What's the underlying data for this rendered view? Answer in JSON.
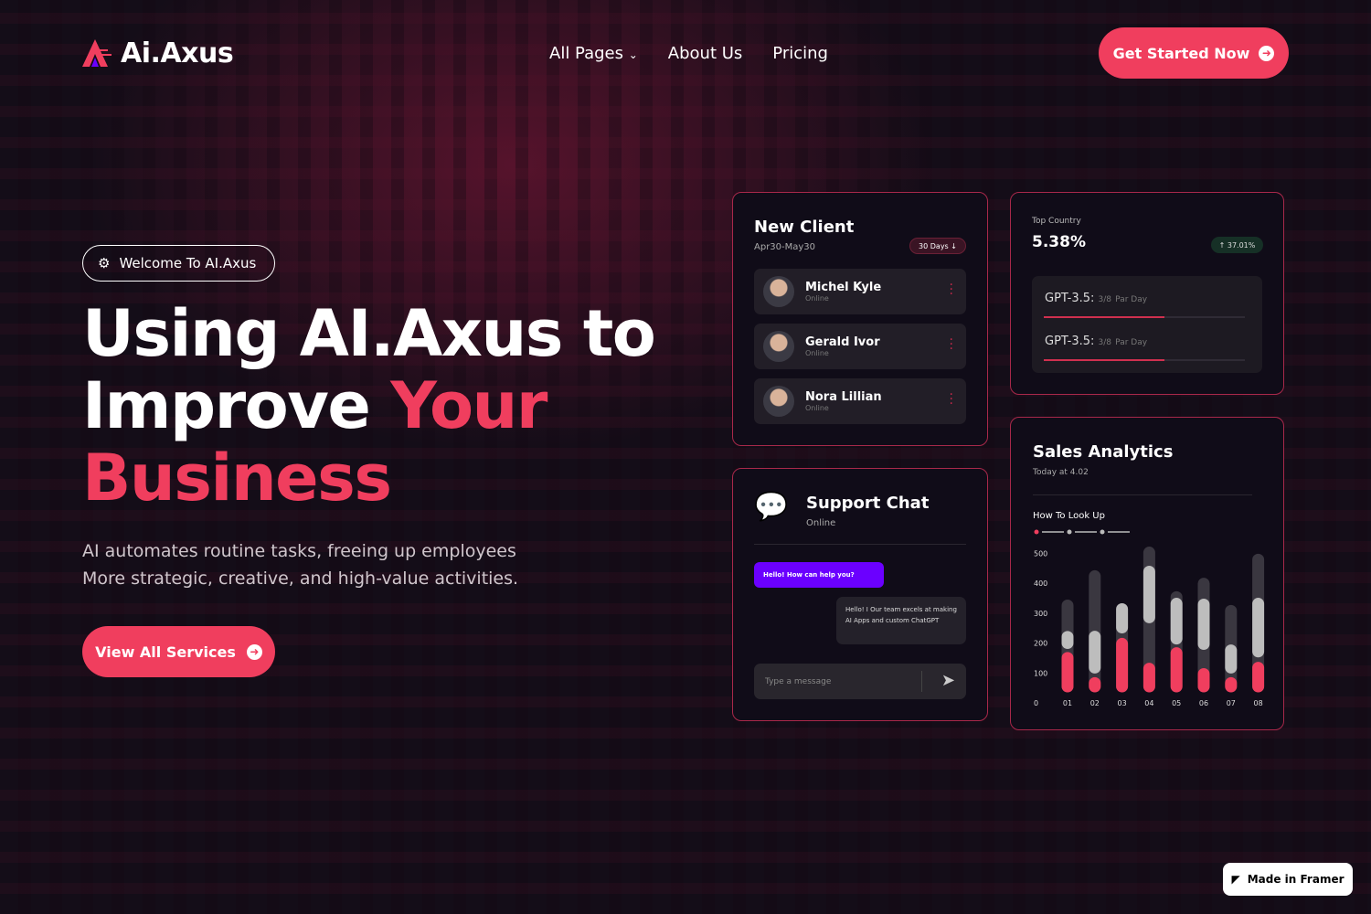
{
  "nav": {
    "logo": "Ai.Axus",
    "items": [
      "All Pages",
      "About Us",
      "Pricing"
    ],
    "cta": "Get Started Now"
  },
  "hero": {
    "badge": "Welcome To AI.Axus",
    "title_line1": "Using AI.Axus to",
    "title_line2a": "Improve ",
    "title_line2b": "Your",
    "title_line3": "Business",
    "sub1": "AI automates routine tasks, freeing up employees",
    "sub2": "More strategic, creative, and high-value activities.",
    "button": "View All Services"
  },
  "new_client": {
    "title": "New Client",
    "range": "Apr30-May30",
    "filter": "30 Days",
    "clients": [
      {
        "name": "Michel Kyle",
        "status": "Online"
      },
      {
        "name": "Gerald Ivor",
        "status": "Online"
      },
      {
        "name": "Nora Lillian",
        "status": "Online"
      }
    ]
  },
  "top_country": {
    "label": "Top Country",
    "value": "5.38%",
    "change": "37.01%",
    "rows": [
      {
        "model": "GPT-3.5:",
        "ratio": "3/8",
        "unit": "Par Day",
        "progress": 0.6
      },
      {
        "model": "GPT-3.5:",
        "ratio": "3/8",
        "unit": "Par Day",
        "progress": 0.6
      }
    ]
  },
  "support": {
    "title": "Support Chat",
    "status": "Online",
    "msg_in": "Hello! How can help you?",
    "msg_out": "Hello! I Our team excels at making AI Apps and custom ChatGPT",
    "placeholder": "Type a message"
  },
  "sales": {
    "title": "Sales Analytics",
    "time": "Today at 4.02",
    "subtitle": "How To Look Up"
  },
  "chart_data": {
    "type": "bar",
    "title": "How To Look Up",
    "categories": [
      "01",
      "02",
      "03",
      "04",
      "05",
      "06",
      "07",
      "08"
    ],
    "yticks": [
      0,
      100,
      200,
      300,
      400,
      500
    ],
    "ylim": [
      0,
      500
    ],
    "series": [
      {
        "name": "total",
        "values": [
          345,
          443,
          333,
          522,
          373,
          418,
          327,
          498
        ]
      },
      {
        "name": "gray_range",
        "values": [
          [
            180,
            240
          ],
          [
            98,
            241
          ],
          [
            232,
            333
          ],
          [
            266,
            458
          ],
          [
            195,
            351
          ],
          [
            177,
            348
          ],
          [
            98,
            195
          ],
          [
            152,
            351
          ]
        ]
      },
      {
        "name": "red",
        "values": [
          170,
          86,
          217,
          134,
          186,
          116,
          86,
          137
        ]
      }
    ],
    "colors": {
      "total": "#3a3740",
      "gray": "#bdbdbd",
      "red": "#f03e5e"
    }
  },
  "footer": {
    "framer": "Made in Framer"
  }
}
